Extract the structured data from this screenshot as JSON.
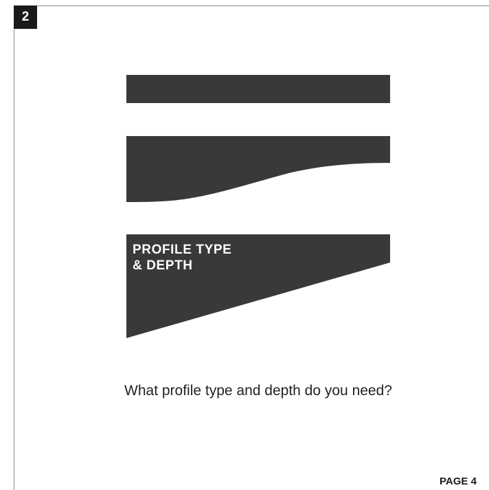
{
  "step_number": "2",
  "option": {
    "title": "PROFILE TYPE\n& DEPTH"
  },
  "question": "What profile type and depth do you need?",
  "page_label": "PAGE 4",
  "colors": {
    "shape_fill": "#3a3939",
    "badge": "#1a1a1a",
    "frame": "#8a8a8a"
  }
}
